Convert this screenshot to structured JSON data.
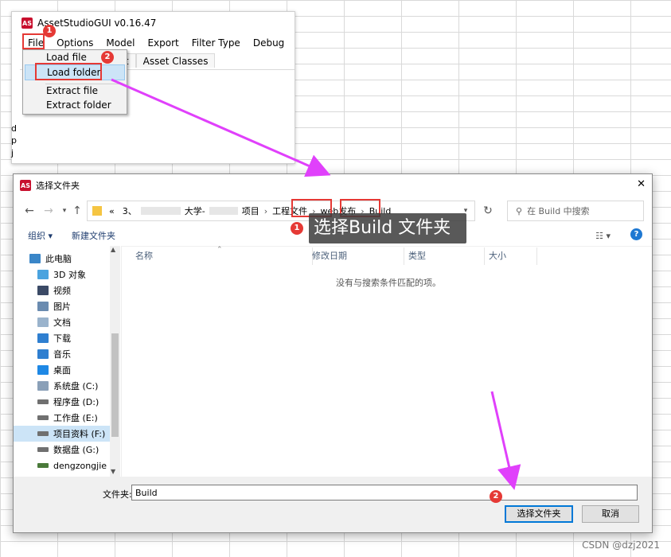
{
  "asset_window": {
    "title": "AssetStudioGUI v0.16.47",
    "logo_text": "AS",
    "menu": [
      "File",
      "Options",
      "Model",
      "Export",
      "Filter Type",
      "Debug"
    ],
    "tabs": [
      "list",
      "Asset Classes"
    ],
    "file_menu": [
      "Load file",
      "Load folder",
      "Extract file",
      "Extract folder"
    ],
    "left_edge_chars": [
      "d",
      "p",
      "j"
    ]
  },
  "dialog": {
    "title": "选择文件夹",
    "close_glyph": "✕",
    "breadcrumb": [
      "«",
      "3、",
      "大学-",
      "项目",
      "工程文件",
      "web发布",
      "Build"
    ],
    "search_placeholder": "在 Build 中搜索",
    "toolbar": {
      "organize": "组织 ▾",
      "new_folder": "新建文件夹"
    },
    "nav_items": [
      {
        "label": "此电脑",
        "icon": "pc-icon"
      },
      {
        "label": "3D 对象",
        "icon": "3d-objects-icon"
      },
      {
        "label": "视频",
        "icon": "video-icon"
      },
      {
        "label": "图片",
        "icon": "pictures-icon"
      },
      {
        "label": "文档",
        "icon": "documents-icon"
      },
      {
        "label": "下载",
        "icon": "download-icon"
      },
      {
        "label": "音乐",
        "icon": "music-icon"
      },
      {
        "label": "桌面",
        "icon": "desktop-icon"
      },
      {
        "label": "系统盘 (C:)",
        "icon": "drive-icon"
      },
      {
        "label": "程序盘 (D:)",
        "icon": "drive-icon"
      },
      {
        "label": "工作盘 (E:)",
        "icon": "drive-icon"
      },
      {
        "label": "项目资料 (F:)",
        "icon": "drive-icon"
      },
      {
        "label": "数据盘 (G:)",
        "icon": "drive-icon"
      },
      {
        "label": "dengzongjie (\\",
        "icon": "network-drive-icon"
      }
    ],
    "columns": [
      "名称",
      "修改日期",
      "类型",
      "大小"
    ],
    "empty_message": "没有与搜索条件匹配的项。",
    "folder_label": "文件夹:",
    "folder_value": "Build",
    "select_button": "选择文件夹",
    "cancel_button": "取消"
  },
  "annotations": {
    "callout": "选择Build 文件夹",
    "badges": [
      "1",
      "2",
      "2",
      "1",
      "2"
    ]
  },
  "watermark": "CSDN @dzj2021",
  "colors": {
    "annotation_red": "#e53935",
    "arrow_magenta": "#e040fb",
    "selection_blue": "#cce4f7",
    "help_blue": "#1e78d2"
  }
}
